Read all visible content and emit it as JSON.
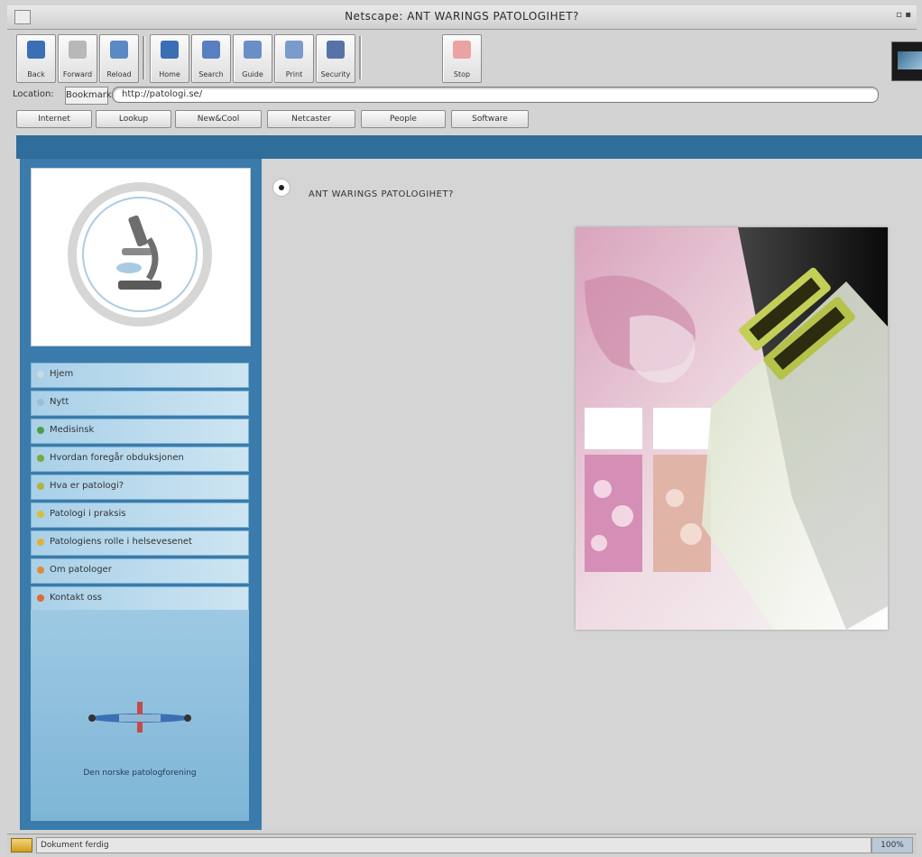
{
  "window": {
    "title": "Netscape: ANT WARINGS PATOLOGIHET?"
  },
  "toolbar": {
    "buttons": [
      {
        "label": "Back",
        "icon": "back-arrow-icon",
        "color": "#3b6fb5"
      },
      {
        "label": "Forward",
        "icon": "forward-arrow-icon",
        "color": "#7c7c7c"
      },
      {
        "label": "Reload",
        "icon": "reload-icon",
        "color": "#3b6fb5"
      },
      {
        "label": "Home",
        "icon": "home-icon",
        "color": "#3b6fb5"
      },
      {
        "label": "Search",
        "icon": "search-icon",
        "color": "#3b6fb5"
      },
      {
        "label": "Guide",
        "icon": "guide-icon",
        "color": "#3b6fb5"
      },
      {
        "label": "Print",
        "icon": "print-icon",
        "color": "#3b6fb5"
      },
      {
        "label": "Security",
        "icon": "security-icon",
        "color": "#3b6fb5"
      },
      {
        "label": "Stop",
        "icon": "stop-icon",
        "color": "#c64a4a"
      }
    ]
  },
  "location": {
    "label": "Location:",
    "bookmarks_label": "Bookmarks",
    "url": "http://patologi.se/"
  },
  "personal_toolbar": {
    "items": [
      "Internet",
      "Lookup",
      "New&Cool",
      "Netcaster",
      "People",
      "Software"
    ]
  },
  "sidebar": {
    "menu": [
      {
        "label": "Hjem",
        "bullet": "#c9d9e6"
      },
      {
        "label": "Nytt",
        "bullet": "#9fbcd6"
      },
      {
        "label": "Medisinsk",
        "bullet": "#4c9d4a"
      },
      {
        "label": "Hvordan foregår obduksjonen",
        "bullet": "#7aa93c"
      },
      {
        "label": "Hva er patologi?",
        "bullet": "#b6b13a"
      },
      {
        "label": "Patologi i praksis",
        "bullet": "#d6be3c"
      },
      {
        "label": "Patologiens rolle i helsevesenet",
        "bullet": "#e0b03a"
      },
      {
        "label": "Om patologer",
        "bullet": "#e38a34"
      },
      {
        "label": "Kontakt oss",
        "bullet": "#de6a32"
      }
    ],
    "footer_link": "Den norske patologforening"
  },
  "content": {
    "heading": "ANT WARINGS PATOLOGIHET?"
  },
  "status": {
    "text": "Dokument ferdig",
    "right": "100%"
  }
}
